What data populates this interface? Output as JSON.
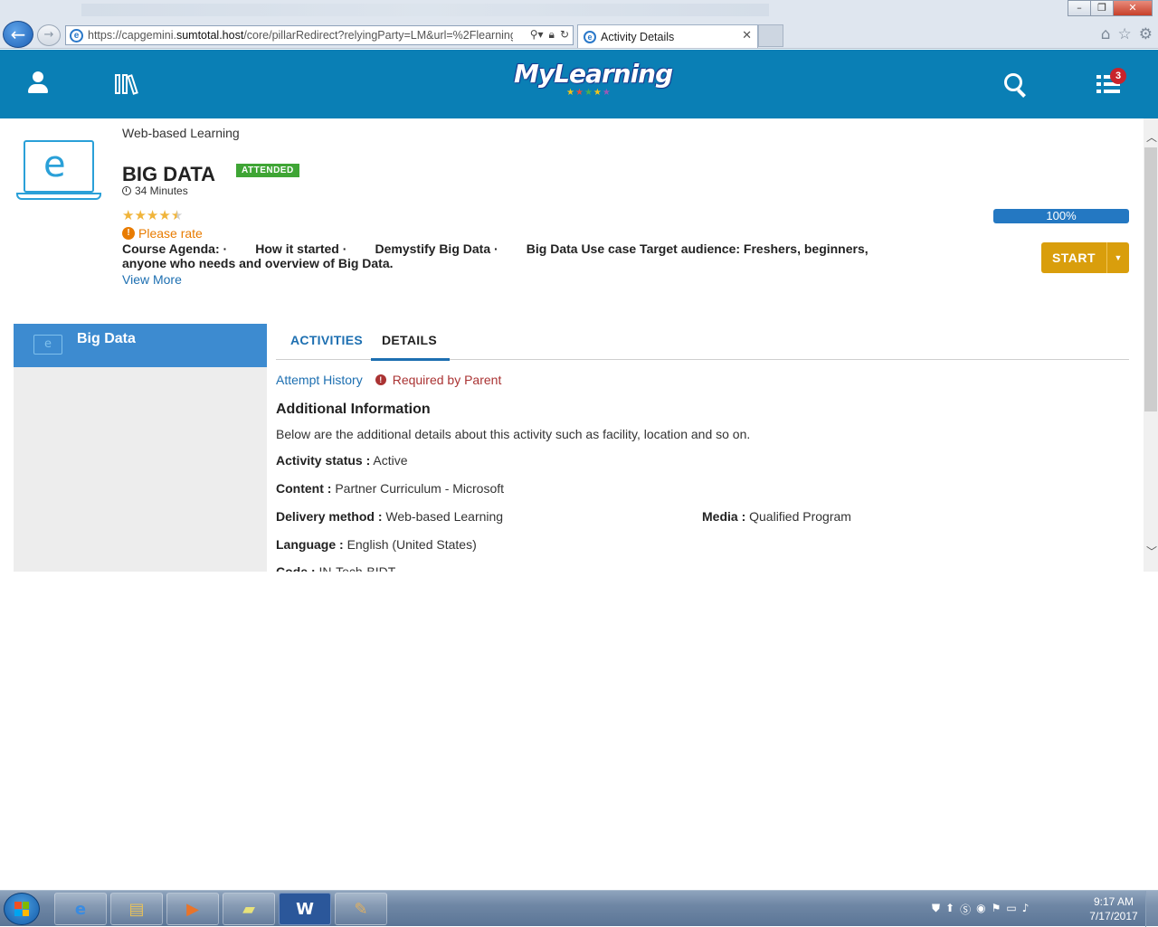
{
  "browser": {
    "url_prefix": "https://capgemini.",
    "url_host": "sumtotal.host",
    "url_rest": "/core/pillarRedirect?relyingParty=LM&url=%2Flearning%",
    "tab_title": "Activity Details"
  },
  "header": {
    "logo_text": "MyLearning",
    "notification_count": "3"
  },
  "course": {
    "delivery_type": "Web-based Learning",
    "title": "BIG DATA",
    "status_badge": "ATTENDED",
    "duration": "34 Minutes",
    "rating_stars": 4.5,
    "please_rate": "Please rate",
    "description": "Course Agenda: ·        How it started ·        Demystify Big Data ·        Big Data Use case Target audience: Freshers, beginners, anyone who needs and overview of Big Data.",
    "view_more": "View More",
    "progress_label": "100%",
    "progress_value": 1.0,
    "start_label": "START"
  },
  "sidebar": {
    "title": "Big Data"
  },
  "tabs": {
    "activities": "ACTIVITIES",
    "details": "DETAILS"
  },
  "details": {
    "attempt_history": "Attempt History",
    "required_by_parent": "Required by Parent",
    "info_title": "Additional Information",
    "info_subtitle": "Below are the additional details about this activity such as facility, location and so on.",
    "fields": {
      "activity_status": {
        "label": "Activity status :",
        "value": "Active"
      },
      "content": {
        "label": "Content :",
        "value": "Partner Curriculum - Microsoft"
      },
      "delivery_method": {
        "label": "Delivery method :",
        "value": "Web-based Learning"
      },
      "media": {
        "label": "Media :",
        "value": "Qualified Program"
      },
      "language": {
        "label": "Language :",
        "value": "English (United States)"
      },
      "code": {
        "label": "Code :",
        "value": "IN-Tech-BIDT"
      }
    }
  },
  "taskbar": {
    "time": "9:17 AM",
    "date": "7/17/2017"
  },
  "colors": {
    "header_blue": "#0a7fb5",
    "attended_green": "#3fa535",
    "start_gold": "#d99e0c",
    "progress_blue": "#2478c2",
    "link_blue": "#1d6fb1",
    "warn_orange": "#e87b00"
  }
}
